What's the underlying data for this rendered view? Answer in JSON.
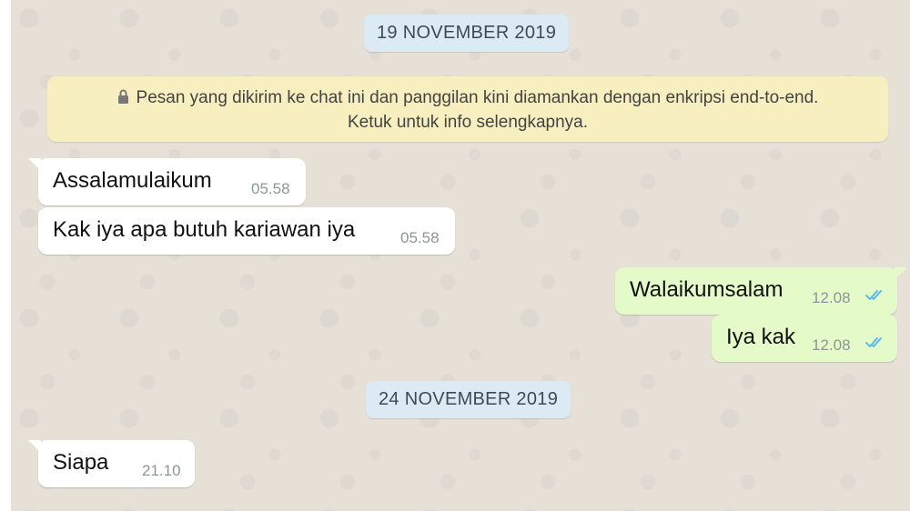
{
  "dates": {
    "first": "19 NOVEMBER 2019",
    "second": "24 NOVEMBER 2019"
  },
  "notice": {
    "line1": "Pesan yang dikirim ke chat ini dan panggilan kini diamankan dengan enkripsi end-to-end.",
    "line2": "Ketuk untuk info selengkapnya."
  },
  "messages": [
    {
      "text": "Assalamulaikum",
      "time": "05.58",
      "direction": "incoming"
    },
    {
      "text": "Kak iya apa butuh kariawan iya",
      "time": "05.58",
      "direction": "incoming"
    },
    {
      "text": "Walaikumsalam",
      "time": "12.08",
      "direction": "outgoing",
      "status": "read"
    },
    {
      "text": "Iya kak",
      "time": "12.08",
      "direction": "outgoing",
      "status": "read"
    },
    {
      "text": "Siapa",
      "time": "21.10",
      "direction": "incoming"
    }
  ],
  "colors": {
    "chat_background": "#e6e0d7",
    "incoming_bubble": "#ffffff",
    "outgoing_bubble": "#e5fac9",
    "date_chip": "#dbeaf3",
    "notice_background": "#f7efbf",
    "read_ticks": "#4fb6ec"
  },
  "icons": {
    "notice": "lock-icon",
    "read_receipt": "double-check-icon"
  }
}
